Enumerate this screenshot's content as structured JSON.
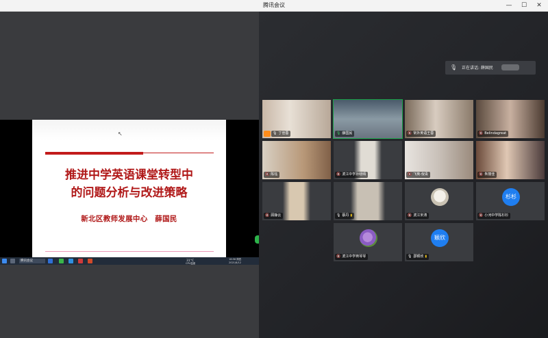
{
  "window": {
    "title": "腾讯会议"
  },
  "window_controls": {
    "minimize": "—",
    "maximize": "☐",
    "close": "✕"
  },
  "slide": {
    "title_line1": "推进中学英语课堂转型中",
    "title_line2": "的问题分析与改进策略",
    "subtitle": "新北区教师发展中心　薛国民"
  },
  "taskbar": {
    "app_label": "腾讯会议",
    "weather": "31°C",
    "cpu": "CPU温度",
    "time": "16:56 周四",
    "date": "2021/8/12"
  },
  "speaking": {
    "label": "正在讲话: 薛国民"
  },
  "participants": [
    {
      "name": "丁佳蓉",
      "kind": "video",
      "host": true
    },
    {
      "name": "薛国民",
      "kind": "video",
      "active": true
    },
    {
      "name": "常外英语王蓉",
      "kind": "video"
    },
    {
      "name": "Belindagreat",
      "kind": "video"
    },
    {
      "name": "陈珏",
      "kind": "video"
    },
    {
      "name": "滨江中学孙晓晴",
      "kind": "video"
    },
    {
      "name": "飞英-倪青",
      "kind": "video"
    },
    {
      "name": "朱丽佳",
      "kind": "video"
    },
    {
      "name": "顾静云",
      "kind": "video"
    },
    {
      "name": "蔡丹",
      "kind": "video"
    },
    {
      "name": "滨江宋涛",
      "kind": "avatar-image"
    },
    {
      "name": "小河中学陈杉杉",
      "kind": "avatar-text",
      "avatar_text": "杉杉"
    },
    {
      "name": "滨江中学蒋琴琴",
      "kind": "avatar-flower"
    },
    {
      "name": "邵颖欣",
      "kind": "avatar-text",
      "avatar_text": "颖欣"
    }
  ],
  "colors": {
    "accent_green": "#1aa34a",
    "slide_red": "#b01818",
    "avatar_blue": "#1f7ef0",
    "host_orange": "#ff8c1a"
  }
}
